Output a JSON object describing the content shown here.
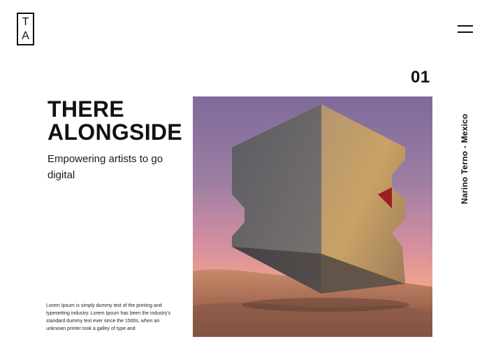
{
  "brand": {
    "logo_letters": [
      "T",
      "A"
    ]
  },
  "nav": {
    "menu_icon": "hamburger-icon"
  },
  "slide": {
    "number": "01"
  },
  "hero": {
    "title_lines": [
      "THERE",
      "ALONGSIDE"
    ],
    "subtitle": "Empowering artists to go digital",
    "body": "Lorem Ipsum is simply dummy text of the printing and typesetting industry. Lorem Ipsum has been the industry's standard dummy text ever since the 1500s, when an unknown printer took a galley of type and",
    "image_description_icon": "floating-cube-artwork"
  },
  "caption": {
    "vertical_text": "Narino Terno - Mexico"
  }
}
